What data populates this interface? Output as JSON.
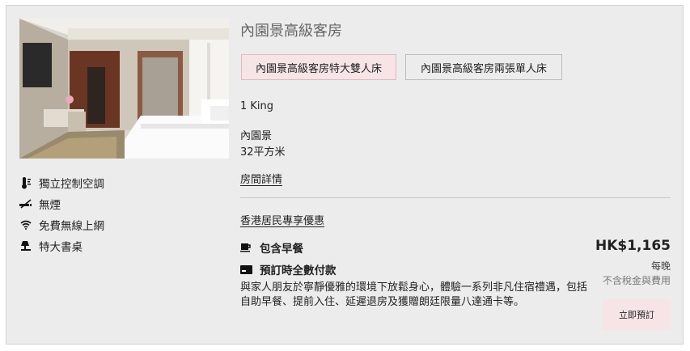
{
  "room": {
    "title": "內園景高級客房",
    "bed_options": [
      "內園景高級客房特大雙人床",
      "內園景高級客房兩張單人床"
    ],
    "bed": "1 King",
    "view": "內園景",
    "size": "32平方米",
    "details_link": "房間詳情"
  },
  "amenities": [
    {
      "icon": "thermometer-icon",
      "label": "獨立控制空調"
    },
    {
      "icon": "no-smoking-icon",
      "label": "無煙"
    },
    {
      "icon": "wifi-icon",
      "label": "免費無線上網"
    },
    {
      "icon": "desk-lamp-icon",
      "label": "特大書桌"
    }
  ],
  "offer": {
    "name": "香港居民專享優惠",
    "breakfast": "包含早餐",
    "payment": "預訂時全數付款",
    "description": "與家人朋友於寧靜優雅的環境下放鬆身心，體驗一系列非凡住宿禮遇，包括自助早餐、提前入住、延遲退房及獲贈朗廷限量八達通卡等。",
    "price": "HK$1,165",
    "per": "每晚",
    "tax_note": "不含稅金與費用",
    "book_label": "立即預訂"
  },
  "colors": {
    "selected_bg": "#f6e4e6",
    "card_bg": "#ececec"
  }
}
